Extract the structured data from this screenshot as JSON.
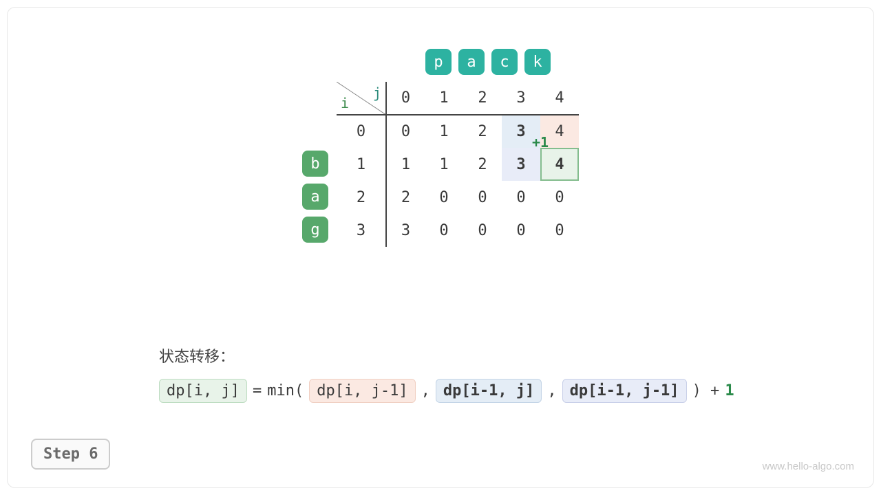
{
  "source": {
    "chars": [
      "b",
      "a",
      "g"
    ]
  },
  "target": {
    "chars": [
      "p",
      "a",
      "c",
      "k"
    ]
  },
  "axes": {
    "i_label": "i",
    "j_label": "j"
  },
  "dp": {
    "col_headers": [
      "0",
      "1",
      "2",
      "3",
      "4"
    ],
    "row_headers": [
      "0",
      "1",
      "2",
      "3"
    ],
    "rows": [
      [
        {
          "v": "0"
        },
        {
          "v": "1"
        },
        {
          "v": "2"
        },
        {
          "v": "3",
          "bold": true,
          "hl": "blue"
        },
        {
          "v": "4",
          "hl": "red"
        }
      ],
      [
        {
          "v": "1"
        },
        {
          "v": "1"
        },
        {
          "v": "2"
        },
        {
          "v": "3",
          "bold": true,
          "hl": "blue2"
        },
        {
          "v": "4",
          "bold": true,
          "hl": "green",
          "plusone": true
        }
      ],
      [
        {
          "v": "2"
        },
        {
          "v": "0",
          "faded": true
        },
        {
          "v": "0",
          "faded": true
        },
        {
          "v": "0",
          "faded": true
        },
        {
          "v": "0",
          "faded": true
        }
      ],
      [
        {
          "v": "3"
        },
        {
          "v": "0",
          "faded": true
        },
        {
          "v": "0",
          "faded": true
        },
        {
          "v": "0",
          "faded": true
        },
        {
          "v": "0",
          "faded": true
        }
      ]
    ],
    "plusone_label": "+1"
  },
  "formula": {
    "title": "状态转移：",
    "lhs": "dp[i, j]",
    "eq": "=",
    "min": "min(",
    "t1": "dp[i, j-1]",
    "c1": ",",
    "t2": "dp[i-1, j]",
    "c2": ",",
    "t3": "dp[i-1, j-1]",
    "close": ") +",
    "one": "1"
  },
  "step": "Step 6",
  "watermark": "www.hello-algo.com"
}
